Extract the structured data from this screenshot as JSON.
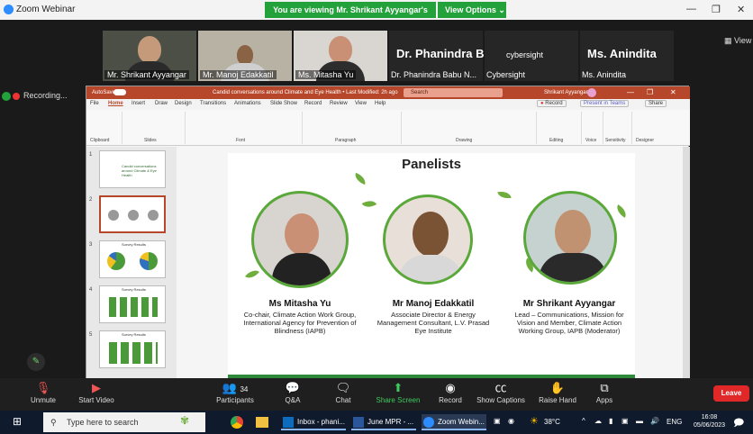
{
  "titlebar": {
    "app_name": "Zoom Webinar",
    "banner": "You are viewing Mr. Shrikant Ayyangar's screen",
    "view_options": "View Options"
  },
  "tiles": [
    {
      "name": "Mr. Shrikant Ayyangar"
    },
    {
      "name": "Mr. Manoj Edakkatil"
    },
    {
      "name": "Ms. Mitasha Yu"
    },
    {
      "big": "Dr. Phanindra B...",
      "name": "Dr. Phanindra Babu N..."
    },
    {
      "big": "cybersight",
      "name": "Cybersight"
    },
    {
      "big": "Ms. Anindita",
      "name": "Ms. Anindita"
    }
  ],
  "view_label": "View",
  "recording": "Recording...",
  "ppt": {
    "autosave": "AutoSave",
    "doc_title": "Candid conversations around Climate and Eye Health • Last Modified: 2h ago",
    "search": "Search",
    "user": "Shrikant Ayyangar",
    "record_btn": "Record",
    "present_btn": "Present in Teams",
    "share_btn": "Share",
    "tabs": [
      "File",
      "Home",
      "Insert",
      "Draw",
      "Design",
      "Transitions",
      "Animations",
      "Slide Show",
      "Record",
      "Review",
      "View",
      "Help"
    ],
    "groups": [
      "Clipboard",
      "Slides",
      "Font",
      "Paragraph",
      "Drawing",
      "Editing",
      "Voice",
      "Sensitivity",
      "Designer"
    ],
    "thumb1_text": "Candid conversations around Climate & Eye Health",
    "thumb_label": "Survey Results",
    "thumb_numbers": [
      "1",
      "2",
      "3",
      "4",
      "5"
    ]
  },
  "slide": {
    "title": "Panelists",
    "panelists": [
      {
        "name": "Ms Mitasha Yu",
        "role": "Co-chair, Climate Action Work Group, International Agency for Prevention of Blindness (IAPB)"
      },
      {
        "name": "Mr Manoj Edakkatil",
        "role": "Associate Director & Energy Management Consultant, L.V. Prasad Eye Institute"
      },
      {
        "name": "Mr Shrikant Ayyangar",
        "role": "Lead – Communications, Mission for Vision and Member, Climate Action Working Group, IAPB (Moderator)"
      }
    ]
  },
  "controls": {
    "unmute": "Unmute",
    "start_video": "Start Video",
    "participants": "Participants",
    "participant_count": "34",
    "qa": "Q&A",
    "chat": "Chat",
    "share": "Share Screen",
    "record": "Record",
    "captions": "Show Captions",
    "raise": "Raise Hand",
    "apps": "Apps",
    "leave": "Leave"
  },
  "taskbar": {
    "search": "Type here to search",
    "apps": [
      "Inbox - phani...",
      "June MPR - ...",
      "Zoom Webin..."
    ],
    "temp": "38°C",
    "lang": "ENG",
    "time": "16:08",
    "date": "05/06/2023"
  },
  "colors": {
    "zoom_green": "#23a13a",
    "ppt_red": "#b7472a",
    "leaf_green": "#6fae3c",
    "leave_red": "#e02828"
  }
}
